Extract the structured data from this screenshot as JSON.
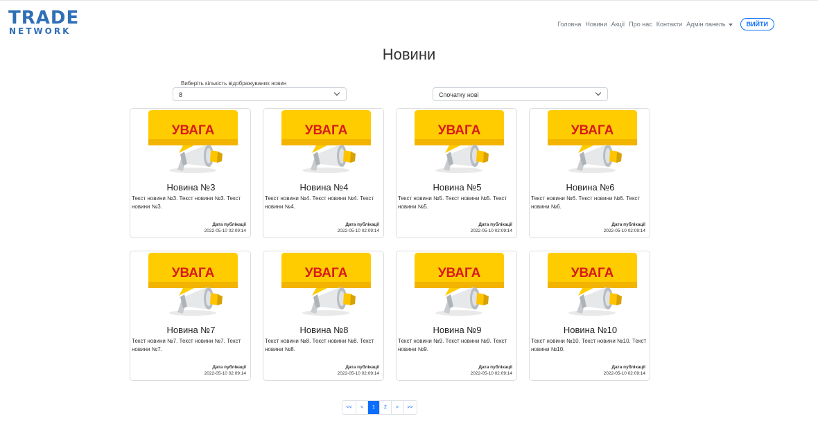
{
  "brand": {
    "line1": "TRADE",
    "line2": "NETWORK"
  },
  "nav": {
    "items": [
      "Головна",
      "Новини",
      "Акції",
      "Про нас",
      "Контакти"
    ],
    "admin": "Адмін панель",
    "login": "ВИЙТИ"
  },
  "page": {
    "title": "Новини"
  },
  "filters": {
    "count_label": "Виберіть кількість відображуваних новин",
    "count_value": "8",
    "sort_value": "Спочатку нові"
  },
  "colors": {
    "accent": "#0d6efd",
    "banner": "#ffcc00",
    "banner_text": "#d81b1b"
  },
  "cards": [
    {
      "image_text": "УВАГА",
      "title": "Новина №3",
      "text": "Текст новини №3. Текст новини №3. Текст новини №3.",
      "date_label": "Дата публікації",
      "date": "2022-05-10 02:09:14"
    },
    {
      "image_text": "УВАГА",
      "title": "Новина №4",
      "text": "Текст новини №4. Текст новини №4. Текст новини №4.",
      "date_label": "Дата публікації",
      "date": "2022-05-10 02:09:14"
    },
    {
      "image_text": "УВАГА",
      "title": "Новина №5",
      "text": "Текст новини №5. Текст новини №5. Текст новини №5.",
      "date_label": "Дата публікації",
      "date": "2022-05-10 02:09:14"
    },
    {
      "image_text": "УВАГА",
      "title": "Новина №6",
      "text": "Текст новини №6. Текст новини №6. Текст новини №6.",
      "date_label": "Дата публікації",
      "date": "2022-05-10 02:09:14"
    },
    {
      "image_text": "УВАГА",
      "title": "Новина №7",
      "text": "Текст новини №7. Текст новини №7. Текст новини №7.",
      "date_label": "Дата публікації",
      "date": "2022-05-10 02:09:14"
    },
    {
      "image_text": "УВАГА",
      "title": "Новина №8",
      "text": "Текст новини №8. Текст новини №8. Текст новини №8.",
      "date_label": "Дата публікації",
      "date": "2022-05-10 02:09:14"
    },
    {
      "image_text": "УВАГА",
      "title": "Новина №9",
      "text": "Текст новини №9. Текст новини №9. Текст новини №9.",
      "date_label": "Дата публікації",
      "date": "2022-05-10 02:09:14"
    },
    {
      "image_text": "УВАГА",
      "title": "Новина №10",
      "text": "Текст новини №10. Текст новини №10. Текст новини №10.",
      "date_label": "Дата публікації",
      "date": "2022-05-10 02:09:14"
    }
  ],
  "pagination": {
    "first": "<<",
    "prev": "<",
    "pages": [
      "1",
      "2"
    ],
    "current": "1",
    "next": ">",
    "last": ">>"
  }
}
